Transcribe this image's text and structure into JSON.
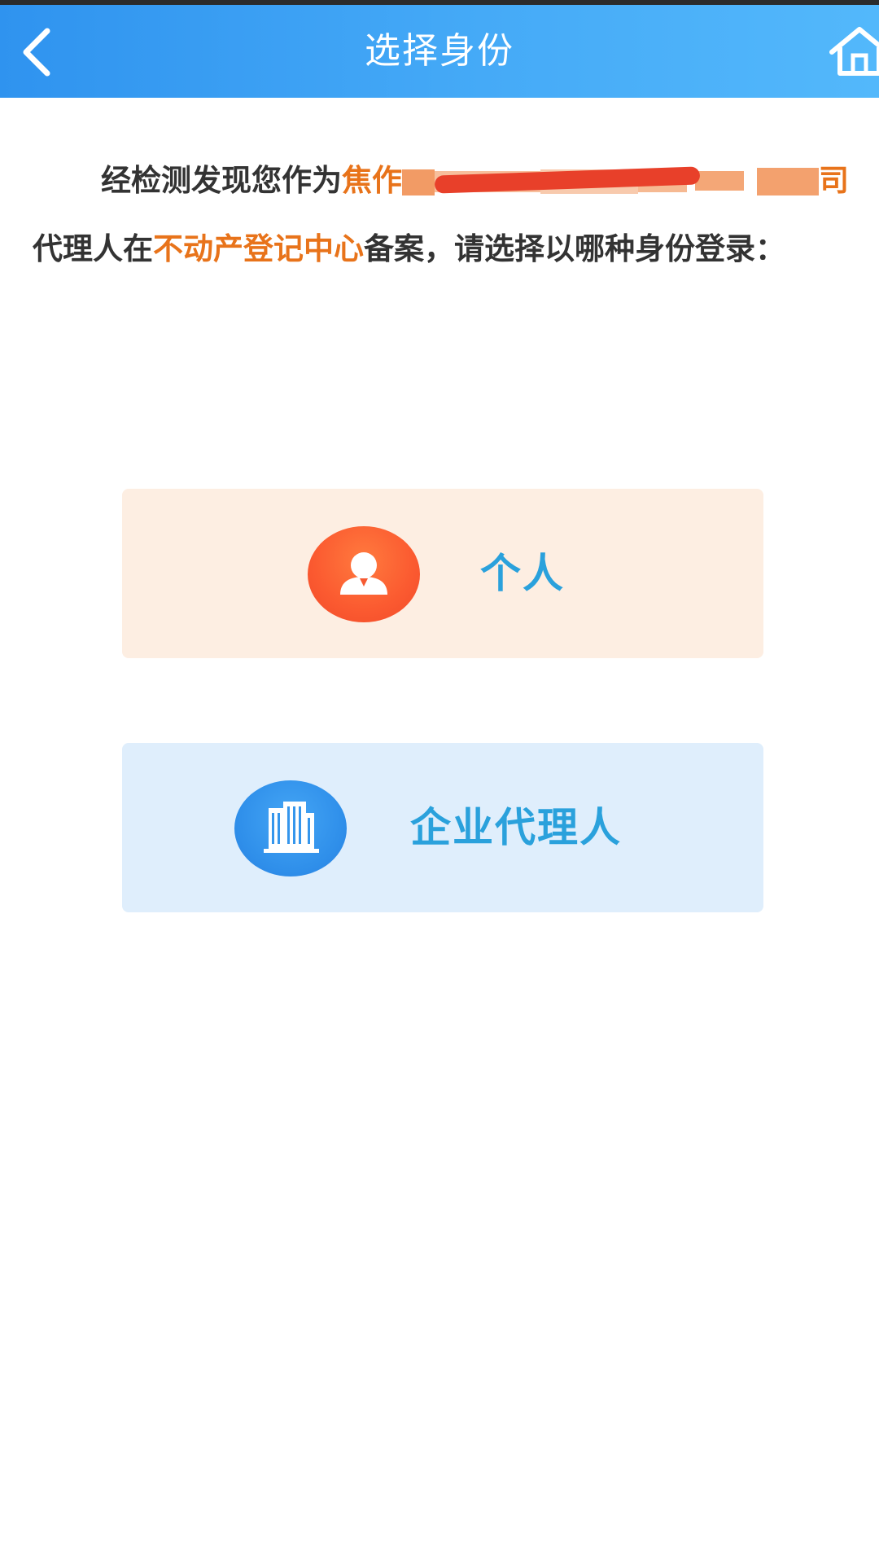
{
  "navbar": {
    "title": "选择身份",
    "back_icon": "chevron-left-icon",
    "home_icon": "home-icon"
  },
  "notice": {
    "prefix": "经检测发现您作为",
    "company_visible_start": "焦作",
    "company_visible_end": "司",
    "middle": "代理人在",
    "center": "不动产登记中心",
    "suffix": "备案，请选择以哪种身份登录："
  },
  "options": {
    "personal": {
      "label": "个人",
      "icon": "person-icon"
    },
    "enterprise": {
      "label": "企业代理人",
      "icon": "building-icon"
    }
  },
  "colors": {
    "navbar": "#3a9ff3",
    "highlight": "#e8731a",
    "option_label": "#2aa1dc",
    "personal_bg": "#fdeee2",
    "enterprise_bg": "#dfeefc"
  }
}
